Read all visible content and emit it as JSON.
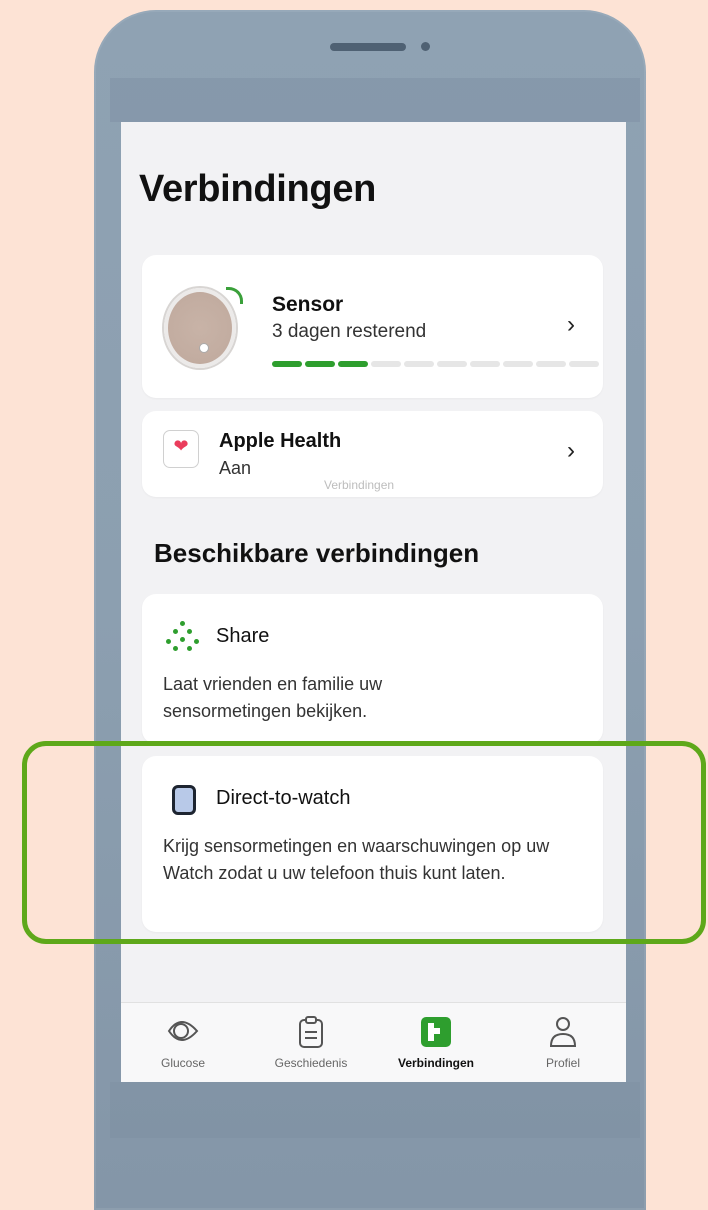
{
  "header": {
    "title": "Verbindingen"
  },
  "sensor_card": {
    "title": "Sensor",
    "subtitle": "3 dagen resterend",
    "progress": {
      "filled_segments": 3,
      "total_segments": 10
    },
    "chevron": "›"
  },
  "apple_health_card": {
    "title": "Apple Health",
    "status": "Aan",
    "ghost_label": "Verbindingen",
    "chevron": "›"
  },
  "available_section": {
    "title": "Beschikbare verbindingen"
  },
  "share_card": {
    "title": "Share",
    "description": "Laat vrienden en familie uw sensormetingen bekijken."
  },
  "watch_card": {
    "title": "Direct-to-watch",
    "description": "Krijg sensormetingen en waarschuwingen op uw Watch zodat u uw telefoon thuis kunt laten."
  },
  "tabbar": {
    "tabs": [
      {
        "label": "Glucose",
        "icon": "eye-drop-icon",
        "active": false
      },
      {
        "label": "Geschiedenis",
        "icon": "clipboard-icon",
        "active": false
      },
      {
        "label": "Verbindingen",
        "icon": "connections-icon",
        "active": true
      },
      {
        "label": "Profiel",
        "icon": "person-icon",
        "active": false
      }
    ]
  },
  "colors": {
    "accent_green": "#2e9e2e",
    "highlight_green": "#5ea81a",
    "background_peach": "#fde3d5",
    "heart_red": "#ea3d5c"
  }
}
